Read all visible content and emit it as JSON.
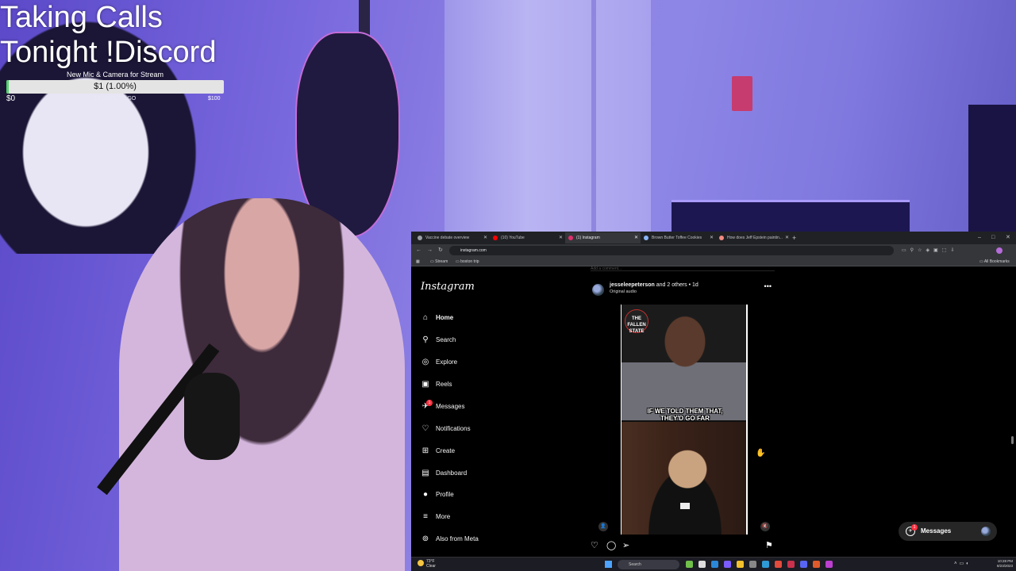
{
  "overlay": {
    "title_line1": "Taking Calls",
    "title_line2": "Tonight !Discord",
    "goal_label": "New Mic & Camera for Stream",
    "goal_amount": "$1 (1.00%)",
    "goal_progress_percent": 1,
    "goal_min": "$0",
    "goal_days": "17 DAYS TO GO",
    "goal_max": "$100"
  },
  "browser": {
    "tabs": [
      {
        "label": "Vaccine debate overview",
        "favicon_color": "#9aa0a6"
      },
      {
        "label": "(10) YouTube",
        "favicon_color": "#ff0000"
      },
      {
        "label": "(1) Instagram",
        "favicon_color": "#e1306c"
      },
      {
        "label": "Brown Butter Toffee Cookies",
        "favicon_color": "#8ab4f8"
      },
      {
        "label": "How does Jeff Epstein paintin...",
        "favicon_color": "#f28b82"
      }
    ],
    "new_tab": "+",
    "window_controls": {
      "minimize": "–",
      "maximize": "□",
      "close": "✕"
    },
    "nav": {
      "back": "←",
      "forward": "→",
      "reload": "↻"
    },
    "url": "instagram.com",
    "bookmarks": [
      "Stream",
      "boston trip"
    ],
    "all_bookmarks": "All Bookmarks"
  },
  "instagram": {
    "logo": "Instagram",
    "nav_items": [
      {
        "label": "Home",
        "icon": "home-icon",
        "glyph": "⌂",
        "active": true
      },
      {
        "label": "Search",
        "icon": "search-icon",
        "glyph": "⚲"
      },
      {
        "label": "Explore",
        "icon": "compass-icon",
        "glyph": "◎"
      },
      {
        "label": "Reels",
        "icon": "reels-icon",
        "glyph": "▣"
      },
      {
        "label": "Messages",
        "icon": "messenger-icon",
        "glyph": "✈",
        "badge": "1"
      },
      {
        "label": "Notifications",
        "icon": "heart-icon",
        "glyph": "♡"
      },
      {
        "label": "Create",
        "icon": "plus-square-icon",
        "glyph": "⊞"
      },
      {
        "label": "Dashboard",
        "icon": "dashboard-icon",
        "glyph": "▤"
      },
      {
        "label": "Profile",
        "icon": "avatar-icon",
        "glyph": "●"
      },
      {
        "label": "More",
        "icon": "menu-icon",
        "glyph": "≡"
      },
      {
        "label": "Also from Meta",
        "icon": "meta-icon",
        "glyph": "⊚"
      }
    ],
    "post": {
      "username": "jesseleepeterson",
      "coauthors": "and 2 others",
      "age": "1d",
      "audio": "Original audio",
      "more": "•••",
      "video_logo": "THE FALLEN STATE",
      "video_caption_line1": "IF WE TOLD THEM THAT,",
      "video_caption_line2": "THEY'D GO FAR",
      "previous_post_text": "Add a comment..."
    },
    "messages_pill": {
      "label": "Messages",
      "badge": "1"
    }
  },
  "taskbar": {
    "weather_temp": "73°F",
    "weather_desc": "Clear",
    "search_placeholder": "Search",
    "time": "10:28 PM",
    "date": "8/23/2023"
  }
}
